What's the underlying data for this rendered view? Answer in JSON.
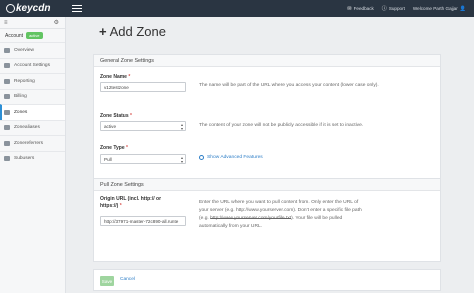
{
  "brand": {
    "logo_text": "keycdn"
  },
  "topbar": {
    "items": [
      {
        "label": "Feedback",
        "icon": "chat-icon"
      },
      {
        "label": "Support",
        "icon": "info-icon"
      },
      {
        "label": "Welcome Parth Gajjar",
        "icon": "user-icon"
      }
    ]
  },
  "sidebar": {
    "menu_icon": "≡",
    "settings_icon": "⚙",
    "account_label": "Account",
    "account_badge": "active",
    "items": [
      {
        "label": "Overview"
      },
      {
        "label": "Account Settings"
      },
      {
        "label": "Reporting"
      },
      {
        "label": "Billing"
      },
      {
        "label": "Zones"
      },
      {
        "label": "Zonealiases"
      },
      {
        "label": "Zonereferrers"
      },
      {
        "label": "Subusers"
      }
    ],
    "active_index": 4
  },
  "page": {
    "title": "Add Zone",
    "title_icon": "plus-icon"
  },
  "general": {
    "heading": "General Zone Settings",
    "zone_name": {
      "label": "Zone Name",
      "required": "*",
      "value": "v12testzone",
      "help": "The name will be part of the URL where you access your content (lower case only)."
    },
    "zone_status": {
      "label": "Zone Status",
      "required": "*",
      "value": "active",
      "help": "The content of your zone will not be publicly accessible if it is set to inactive."
    },
    "zone_type": {
      "label": "Zone Type",
      "required": "*",
      "value": "Pull",
      "advanced_link": "Show Advanced Features"
    }
  },
  "pull": {
    "heading": "Pull Zone Settings",
    "origin": {
      "label_line1": "Origin URL (incl. http:// or",
      "label_line2": "https://)",
      "required": "*",
      "value": "http://37971-master-72c890-all.runte",
      "help_line1": "Enter the URL where you want to pull content from. Only enter the URL of",
      "help_line2a": "your server (e.g. http://www.yourserver.com). Don't enter a specific file path",
      "help_line3a": "(e.g. ",
      "help_line3_struck": "http://www.yourserver.com/yourfile.txt",
      "help_line3b": "). Your file will be pulled",
      "help_line4": "automatically from your URL."
    }
  },
  "actions": {
    "save": "Save",
    "cancel": "Cancel"
  },
  "colors": {
    "topbar": "#2a3542",
    "link": "#2d7ec7",
    "save": "#9fd59f",
    "badge": "#62c462",
    "active_border": "#2d8fd5"
  }
}
